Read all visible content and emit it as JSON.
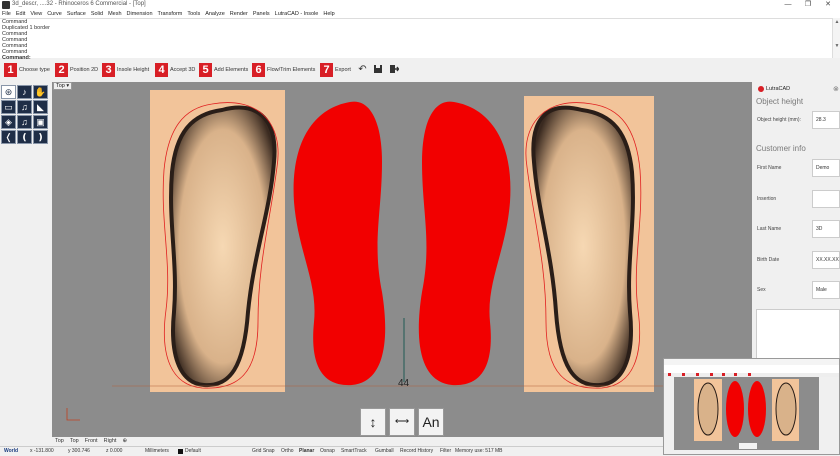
{
  "window": {
    "title": "3d_descr, ....32 - Rhinoceros 6 Commercial - [Top]",
    "controls": [
      "—",
      "❐",
      "✕"
    ]
  },
  "menu": [
    "File",
    "Edit",
    "View",
    "Curve",
    "Surface",
    "Solid",
    "Mesh",
    "Dimension",
    "Transform",
    "Tools",
    "Analyze",
    "Render",
    "Panels",
    "LutraCAD - Insole",
    "Help"
  ],
  "command_history": [
    "Command",
    "Duplicated 1 border",
    "Command",
    "Command",
    "Command",
    "Command"
  ],
  "command_prompt": "Command:",
  "steps": [
    {
      "num": "1",
      "label": "Choose type"
    },
    {
      "num": "2",
      "label": "Position 2D"
    },
    {
      "num": "3",
      "label": "Insole Height"
    },
    {
      "num": "4",
      "label": "Accept 3D"
    },
    {
      "num": "5",
      "label": "Add Elements"
    },
    {
      "num": "6",
      "label": "Flow/Trim Elements"
    },
    {
      "num": "7",
      "label": "Export"
    }
  ],
  "viewport": {
    "label": "Top ▾",
    "dimension_text": "44"
  },
  "viewport_buttons": [
    "↕",
    "⟷",
    "An"
  ],
  "view_tabs": [
    "Top",
    "Top",
    "Front",
    "Right",
    "⊕"
  ],
  "panel": {
    "brand": "LutraCAD",
    "section1": "Object height",
    "object_height_label": "Object height (mm):",
    "object_height_value": "28.3",
    "section2": "Customer info",
    "fields": [
      {
        "label": "First Name",
        "value": "Demo"
      },
      {
        "label": "Insertion",
        "value": ""
      },
      {
        "label": "Last Name",
        "value": "3D"
      },
      {
        "label": "Birth Date",
        "value": "XX.XX.XXXX"
      },
      {
        "label": "Sex",
        "value": "Male"
      }
    ]
  },
  "status": {
    "world": "World",
    "x": "x -131.800",
    "y": "y 300.746",
    "z": "z 0.000",
    "units": "Millimeters",
    "layer": "Default",
    "toggles": [
      "Grid Snap",
      "Ortho",
      "Planar",
      "Osnap",
      "SmartTrack",
      "Gumball",
      "Record History",
      "Filter"
    ],
    "memory": "Memory use: 517 MB"
  },
  "colors": {
    "accent_red": "#d81f26",
    "insole_red": "#f20000",
    "skin": "#f2c49a",
    "viewport_bg": "#8c8c8c"
  }
}
